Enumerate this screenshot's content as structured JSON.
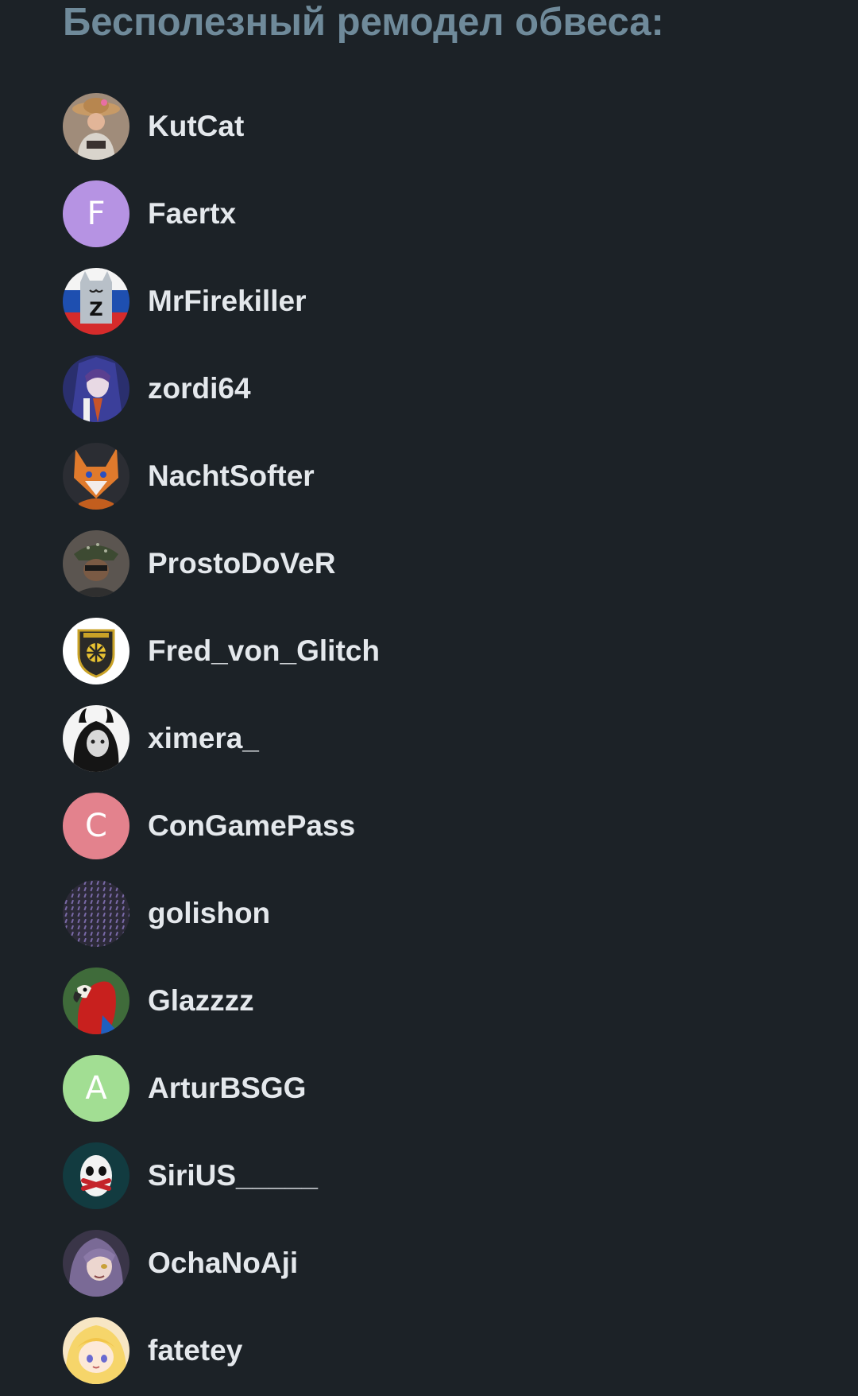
{
  "title": "Бесполезный ремодел обвеса:",
  "users": [
    {
      "name": "KutCat",
      "avatar": {
        "kind": "photo",
        "icon": "person-cowboy-hat-icon"
      }
    },
    {
      "name": "Faertx",
      "avatar": {
        "kind": "letter",
        "letter": "F",
        "color": "#b693e3"
      }
    },
    {
      "name": "MrFirekiller",
      "avatar": {
        "kind": "photo",
        "icon": "z-cat-russian-flag-icon"
      }
    },
    {
      "name": "zordi64",
      "avatar": {
        "kind": "photo",
        "icon": "anime-dark-hair-icon"
      }
    },
    {
      "name": "NachtSofter",
      "avatar": {
        "kind": "photo",
        "icon": "orange-fox-icon"
      }
    },
    {
      "name": "ProstoDoVeR",
      "avatar": {
        "kind": "photo",
        "icon": "man-bucket-hat-icon"
      }
    },
    {
      "name": "Fred_von_Glitch",
      "avatar": {
        "kind": "photo",
        "icon": "shield-emblem-icon"
      }
    },
    {
      "name": "ximera_",
      "avatar": {
        "kind": "photo",
        "icon": "horned-girl-icon"
      }
    },
    {
      "name": "ConGamePass",
      "avatar": {
        "kind": "letter",
        "letter": "C",
        "color": "#e3828d"
      }
    },
    {
      "name": "golishon",
      "avatar": {
        "kind": "photo",
        "icon": "dot-pattern-icon"
      }
    },
    {
      "name": "Glazzzz",
      "avatar": {
        "kind": "photo",
        "icon": "red-parrot-icon"
      }
    },
    {
      "name": "ArturBSGG",
      "avatar": {
        "kind": "letter",
        "letter": "A",
        "color": "#a2de93"
      }
    },
    {
      "name": "SiriUS_____",
      "avatar": {
        "kind": "photo",
        "icon": "taped-mask-icon"
      }
    },
    {
      "name": "OchaNoAji",
      "avatar": {
        "kind": "photo",
        "icon": "anime-purple-hair-icon"
      }
    },
    {
      "name": "fatetey",
      "avatar": {
        "kind": "photo",
        "icon": "anime-blonde-girl-icon"
      }
    }
  ]
}
